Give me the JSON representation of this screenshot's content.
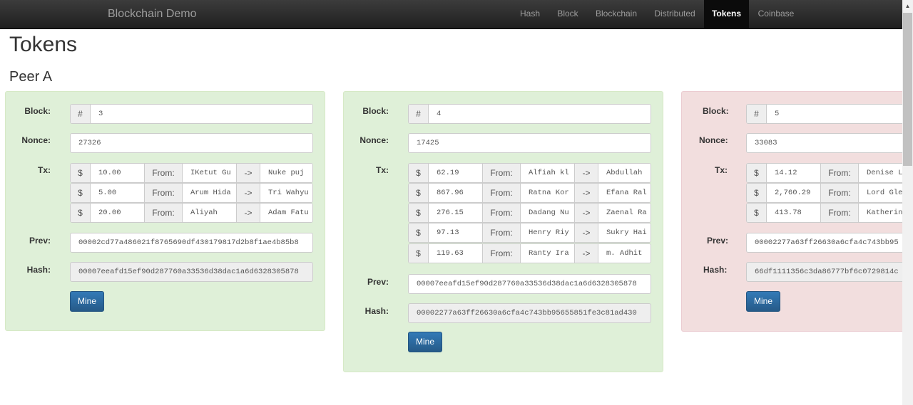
{
  "navbar": {
    "brand": "Blockchain Demo",
    "items": [
      {
        "label": "Hash",
        "active": false
      },
      {
        "label": "Block",
        "active": false
      },
      {
        "label": "Blockchain",
        "active": false
      },
      {
        "label": "Distributed",
        "active": false
      },
      {
        "label": "Tokens",
        "active": true
      },
      {
        "label": "Coinbase",
        "active": false
      }
    ]
  },
  "page": {
    "title": "Tokens",
    "peer": "Peer A"
  },
  "labels": {
    "block": "Block:",
    "nonce": "Nonce:",
    "tx": "Tx:",
    "prev": "Prev:",
    "hash": "Hash:",
    "hash_sign": "#",
    "dollar": "$",
    "from": "From:",
    "arrow": "->",
    "mine": "Mine"
  },
  "colors": {
    "valid_bg": "#dff0d8",
    "invalid_bg": "#f2dede",
    "button": "#337ab7"
  },
  "blocks": [
    {
      "number": "3",
      "nonce": "27326",
      "valid": true,
      "txs": [
        {
          "amount": "10.00",
          "from": "IKetut Gu",
          "to": "Nuke puj"
        },
        {
          "amount": "5.00",
          "from": "Arum Hida",
          "to": "Tri Wahyu"
        },
        {
          "amount": "20.00",
          "from": "Aliyah",
          "to": "Adam Fatu"
        }
      ],
      "prev": "00002cd77a486021f8765690df430179817d2b8f1ae4b85b8",
      "hash": "00007eeafd15ef90d287760a33536d38dac1a6d6328305878"
    },
    {
      "number": "4",
      "nonce": "17425",
      "valid": true,
      "txs": [
        {
          "amount": "62.19",
          "from": "Alfiah kl",
          "to": "Abdullah"
        },
        {
          "amount": "867.96",
          "from": "Ratna Kor",
          "to": "Efana Ral"
        },
        {
          "amount": "276.15",
          "from": "Dadang Nu",
          "to": "Zaenal Ra"
        },
        {
          "amount": "97.13",
          "from": "Henry Riy",
          "to": "Sukry Hai"
        },
        {
          "amount": "119.63",
          "from": "Ranty Ira",
          "to": "m. Adhit"
        }
      ],
      "prev": "00007eeafd15ef90d287760a33536d38dac1a6d6328305878",
      "hash": "00002277a63ff26630a6cfa4c743bb95655851fe3c81ad430"
    },
    {
      "number": "5",
      "nonce": "33083",
      "valid": false,
      "txs": [
        {
          "amount": "14.12",
          "from": "Denise L",
          "to": ""
        },
        {
          "amount": "2,760.29",
          "from": "Lord Gle",
          "to": ""
        },
        {
          "amount": "413.78",
          "from": "Katherin",
          "to": ""
        }
      ],
      "prev": "00002277a63ff26630a6cfa4c743bb95",
      "hash": "66df1111356c3da86777bf6c0729814c"
    }
  ]
}
